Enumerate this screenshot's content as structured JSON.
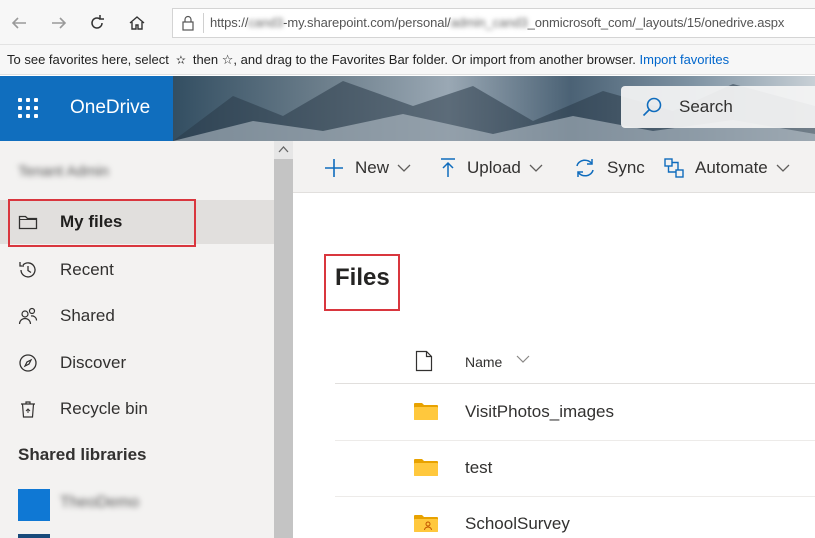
{
  "browser": {
    "url_prefix": "https://",
    "url_hidden_1": "cand3",
    "url_mid": "-my.sharepoint.com/personal/",
    "url_hidden_2": "admin_cand3",
    "url_suffix": "_onmicrosoft_com/_layouts/15/onedrive.aspx"
  },
  "favorites_bar": {
    "text_before": "To see favorites here, select",
    "text_after": "then ☆, and drag to the Favorites Bar folder. Or import from another browser.",
    "import_link": "Import favorites"
  },
  "header": {
    "app_name": "OneDrive",
    "search_label": "Search",
    "brand_color": "#106ebe"
  },
  "sidebar": {
    "tenant_name": "Tenant Admin",
    "items": [
      {
        "label": "My files",
        "icon": "folder-icon",
        "selected": true
      },
      {
        "label": "Recent",
        "icon": "clock-history-icon"
      },
      {
        "label": "Shared",
        "icon": "people-icon"
      },
      {
        "label": "Discover",
        "icon": "compass-icon"
      },
      {
        "label": "Recycle bin",
        "icon": "recycle-bin-icon"
      }
    ],
    "shared_libraries_title": "Shared libraries",
    "libraries": [
      {
        "name": "TheoDemo",
        "color": "#0f78d4"
      }
    ]
  },
  "commands": {
    "new": "New",
    "upload": "Upload",
    "sync": "Sync",
    "automate": "Automate"
  },
  "main": {
    "title": "Files",
    "column_name": "Name",
    "files": [
      {
        "name": "VisitPhotos_images",
        "icon": "folder-icon"
      },
      {
        "name": "test",
        "icon": "folder-icon"
      },
      {
        "name": "SchoolSurvey",
        "icon": "shared-folder-icon"
      }
    ]
  },
  "annotation_color": "#d9363e"
}
